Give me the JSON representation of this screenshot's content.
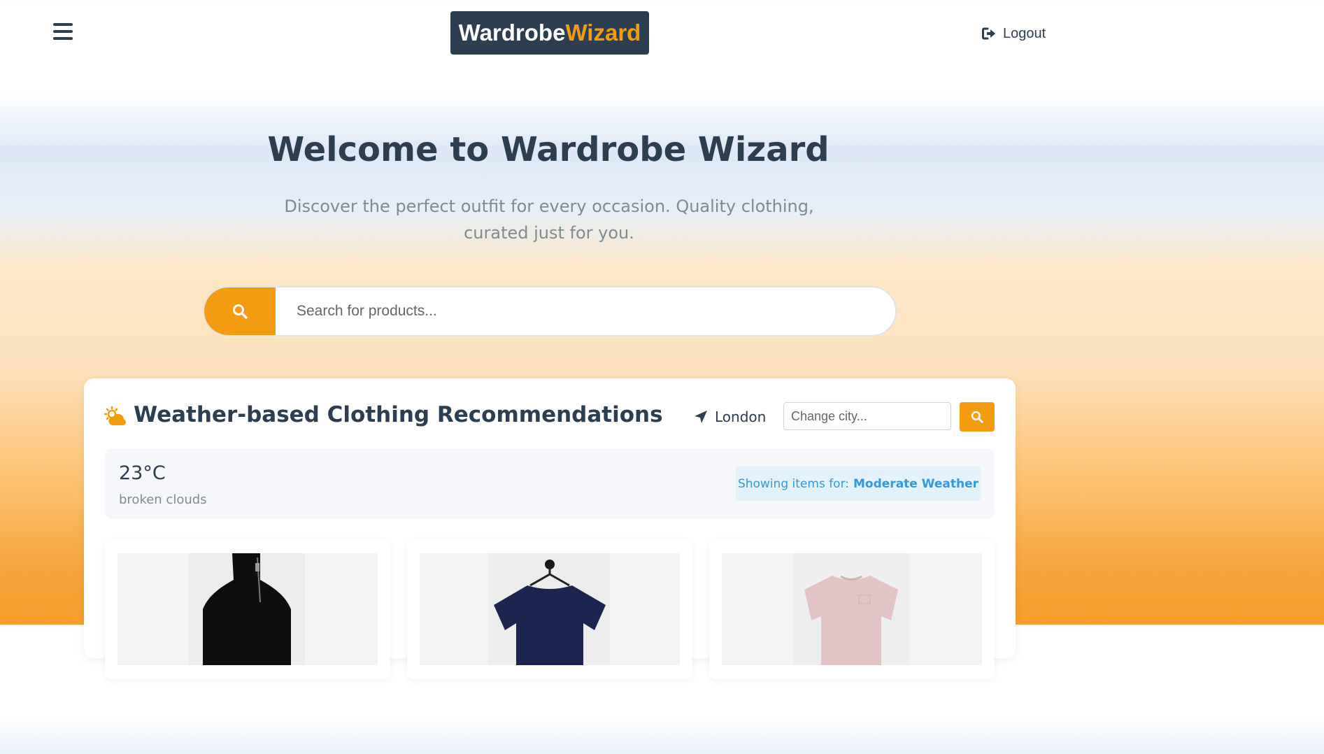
{
  "header": {
    "logo_part1": "Wardrobe",
    "logo_part2": "Wizard",
    "logout_label": "Logout",
    "menu_icon": "hamburger-icon",
    "logout_icon": "sign-out-icon"
  },
  "hero": {
    "title": "Welcome to Wardrobe Wizard",
    "subtitle": "Discover the perfect outfit for every occasion. Quality clothing, curated just for you."
  },
  "search": {
    "placeholder": "Search for products...",
    "icon": "search-icon"
  },
  "weather": {
    "title": "Weather-based Clothing Recommendations",
    "icon": "sun-cloud-icon",
    "location": "London",
    "location_icon": "location-arrow-icon",
    "city_placeholder": "Change city...",
    "temperature": "23°C",
    "description": "broken clouds",
    "showing_label": "Showing items for:",
    "category": "Moderate Weather"
  },
  "products": [
    {
      "image": "black-zip-neck-top"
    },
    {
      "image": "navy-tshirt-on-hanger"
    },
    {
      "image": "pink-tshirt"
    }
  ],
  "colors": {
    "accent": "#f39c12",
    "dark": "#2c3e50",
    "muted": "#7f8c8d",
    "info": "#3498db"
  }
}
